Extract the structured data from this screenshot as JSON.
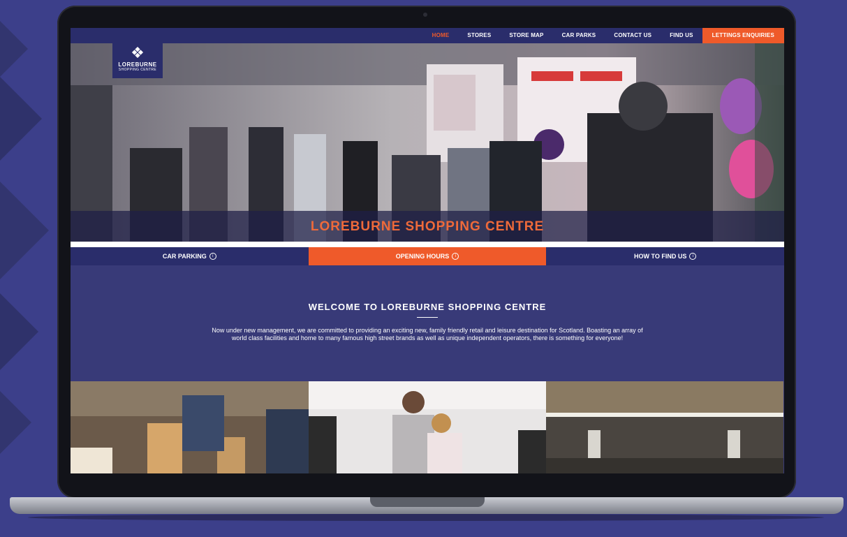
{
  "nav": {
    "items": [
      {
        "label": "HOME",
        "active": true
      },
      {
        "label": "STORES",
        "active": false
      },
      {
        "label": "STORE MAP",
        "active": false
      },
      {
        "label": "CAR PARKS",
        "active": false
      },
      {
        "label": "CONTACT US",
        "active": false
      },
      {
        "label": "FIND US",
        "active": false
      }
    ],
    "cta_label": "LETTINGS ENQUIRIES"
  },
  "logo": {
    "icon": "celtic-knot-icon",
    "name": "LOREBURNE",
    "subtitle": "SHOPPING CENTRE"
  },
  "hero": {
    "title": "LOREBURNE SHOPPING CENTRE"
  },
  "tabs": [
    {
      "label": "CAR PARKING",
      "active": false
    },
    {
      "label": "OPENING HOURS",
      "active": true
    },
    {
      "label": "HOW TO FIND US",
      "active": false
    }
  ],
  "welcome": {
    "title": "WELCOME TO LOREBURNE SHOPPING CENTRE",
    "body": "Now under new management, we are committed to providing an exciting new, family friendly retail and leisure destination for Scotland.  Boasting an array of world class facilities and home to many famous high street brands as well as unique independent operators, there is something for everyone!"
  },
  "colors": {
    "brand_navy": "#2a2d6b",
    "accent_orange": "#ef5a2a",
    "content_bg": "#383a78",
    "page_bg": "#3c3f8a"
  }
}
